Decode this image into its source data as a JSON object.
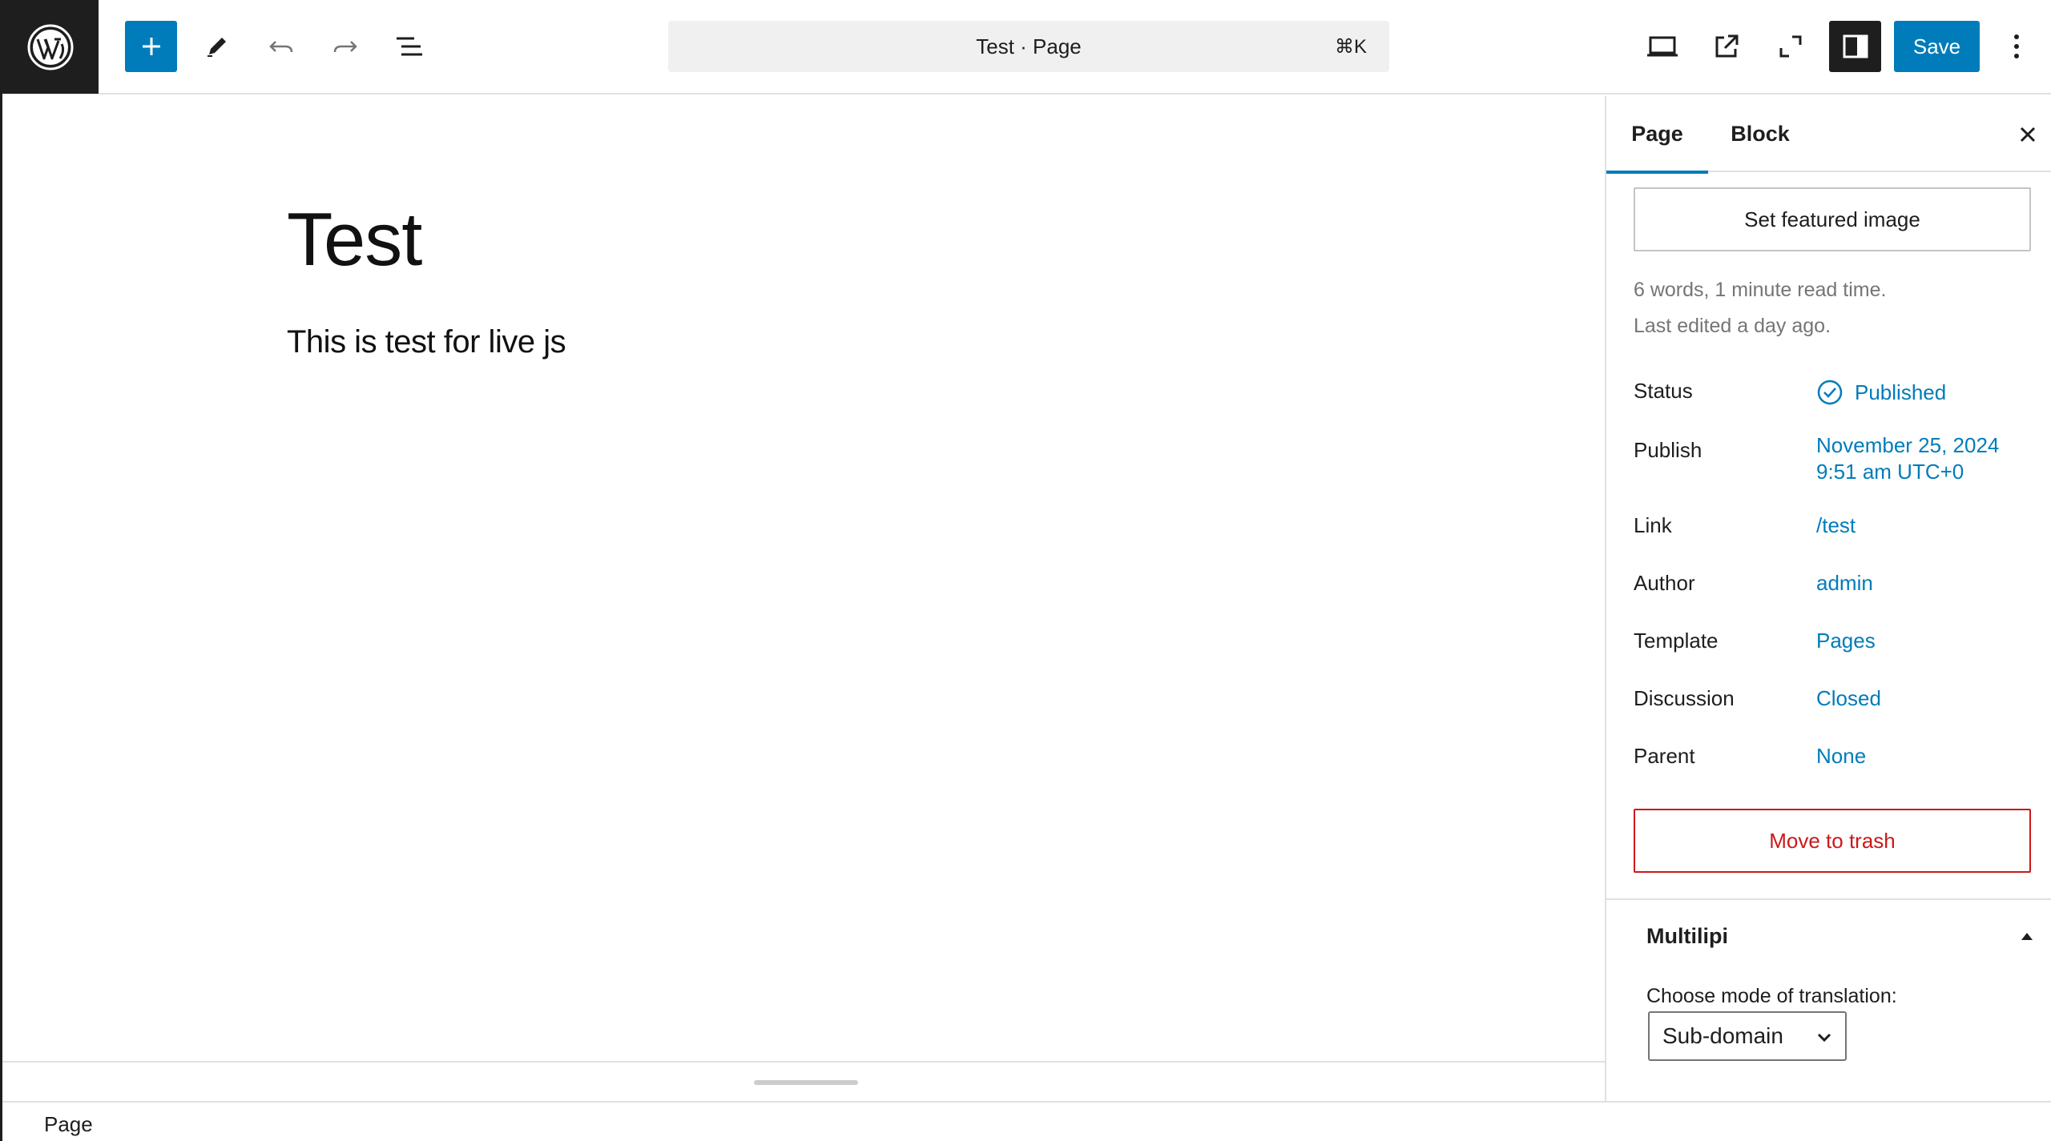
{
  "header": {
    "document_title": "Test · Page",
    "shortcut": "⌘K",
    "save_label": "Save"
  },
  "icons": {
    "logo": "wordpress-logo",
    "add": "plus-icon",
    "tools": "pencil-icon",
    "undo": "undo-icon",
    "redo": "redo-icon",
    "outline": "list-view-icon",
    "view": "desktop-view-icon",
    "preview": "external-link-icon",
    "fullscreen": "fullscreen-icon",
    "settings": "sidebar-toggle-icon",
    "more": "more-vertical-icon",
    "close": "close-icon",
    "status": "check-circle-icon",
    "collapse": "triangle-up-icon",
    "select": "chevron-down-icon"
  },
  "colors": {
    "accent": "#007cba",
    "danger": "#cc1818",
    "dark": "#1e1e1e"
  },
  "editor": {
    "title": "Test",
    "paragraph": "This is test for live js"
  },
  "sidebar": {
    "tabs": [
      "Page",
      "Block"
    ],
    "featured_image_label": "Set featured image",
    "word_count": "6 words, 1 minute read time.",
    "last_edited": "Last edited a day ago.",
    "status": {
      "label": "Status",
      "value": "Published"
    },
    "publish": {
      "label": "Publish",
      "date": "November 25, 2024",
      "time": "9:51 am UTC+0"
    },
    "link": {
      "label": "Link",
      "value": "/test"
    },
    "author": {
      "label": "Author",
      "value": "admin"
    },
    "template": {
      "label": "Template",
      "value": "Pages"
    },
    "discussion": {
      "label": "Discussion",
      "value": "Closed"
    },
    "parent": {
      "label": "Parent",
      "value": "None"
    },
    "trash_label": "Move to trash",
    "plugin_panel": {
      "title": "Multilipi",
      "mode_label": "Choose mode of translation:",
      "mode_value": "Sub-domain"
    }
  },
  "footer": {
    "breadcrumb": "Page"
  }
}
